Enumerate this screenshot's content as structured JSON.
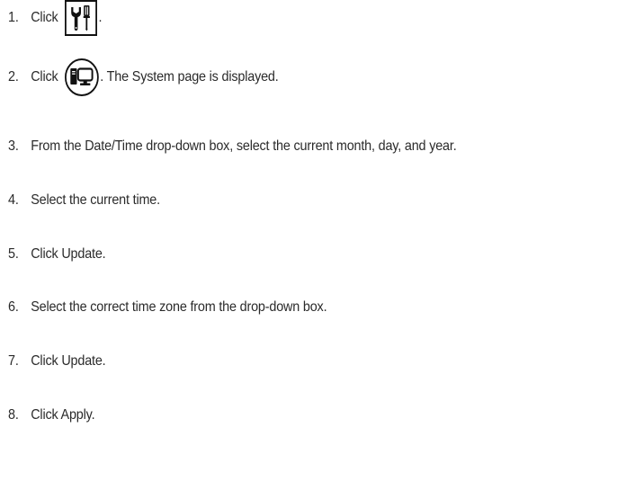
{
  "steps": [
    {
      "number": "1.",
      "text": "Click",
      "icon": "tools-icon",
      "after": "."
    },
    {
      "number": "2.",
      "text": "Click",
      "icon": "system-computer-icon",
      "after": ". The System page is displayed."
    },
    {
      "number": "3.",
      "text": "From the Date/Time drop-down box, select the current month, day, and year."
    },
    {
      "number": "4.",
      "text": "Select the current time."
    },
    {
      "number": "5.",
      "text": "Click Update."
    },
    {
      "number": "6.",
      "text": "Select the correct time zone from the drop-down box."
    },
    {
      "number": "7.",
      "text": "Click Update."
    },
    {
      "number": "8.",
      "text": "Click Apply."
    }
  ]
}
